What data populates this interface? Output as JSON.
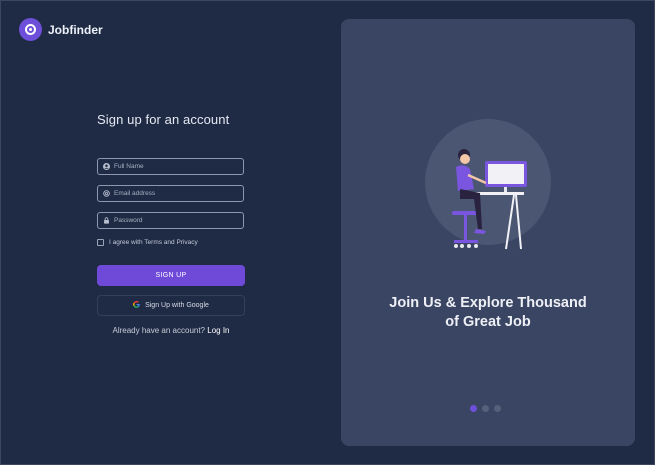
{
  "brand": {
    "name": "Jobfinder",
    "accent": "#6f4ad9"
  },
  "form": {
    "heading": "Sign up for an account",
    "full_name_placeholder": "Full Name",
    "email_placeholder": "Email address",
    "password_placeholder": "Password",
    "terms_label": "I agree with Terms and Privacy",
    "signup_label": "SIGN UP",
    "google_label": "Sign Up with Google",
    "google_icon": "G",
    "login_prompt": "Already have an account?",
    "login_link": "Log In"
  },
  "promo": {
    "tagline_line1": "Join Us & Explore Thousand",
    "tagline_line2": "of Great Job",
    "carousel_count": 3,
    "carousel_active": 1
  }
}
